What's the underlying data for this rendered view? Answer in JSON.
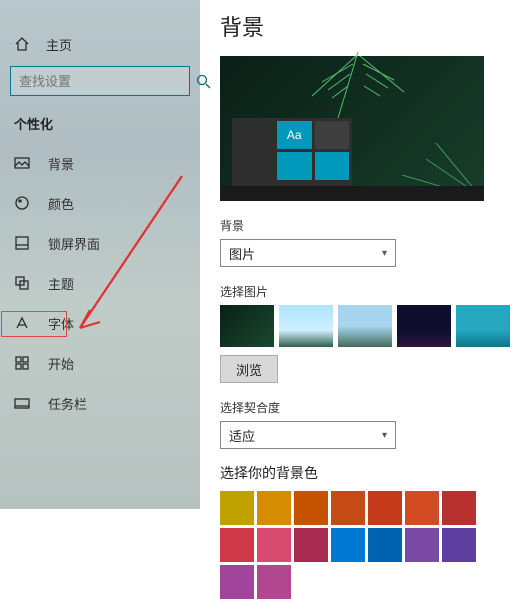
{
  "sidebar": {
    "home": "主页",
    "search_placeholder": "查找设置",
    "category": "个性化",
    "items": [
      {
        "label": "背景"
      },
      {
        "label": "颜色"
      },
      {
        "label": "锁屏界面"
      },
      {
        "label": "主题"
      },
      {
        "label": "字体"
      },
      {
        "label": "开始"
      },
      {
        "label": "任务栏"
      }
    ]
  },
  "main": {
    "title": "背景",
    "preview_tile_text": "Aa",
    "bg_label": "背景",
    "bg_select_value": "图片",
    "choose_picture_label": "选择图片",
    "browse_label": "浏览",
    "fit_label": "选择契合度",
    "fit_select_value": "适应",
    "accent_label": "选择你的背景色",
    "colors": [
      "#bfa100",
      "#d58c00",
      "#c65300",
      "#c44a16",
      "#c43a1a",
      "#d34a23",
      "#b93030",
      "#cf3848",
      "#d84a6f",
      "#a92a50",
      "#0078d4",
      "#0063b1",
      "#7a49a5",
      "#5d3fa0",
      "#a0459a",
      "#b1478e"
    ]
  }
}
